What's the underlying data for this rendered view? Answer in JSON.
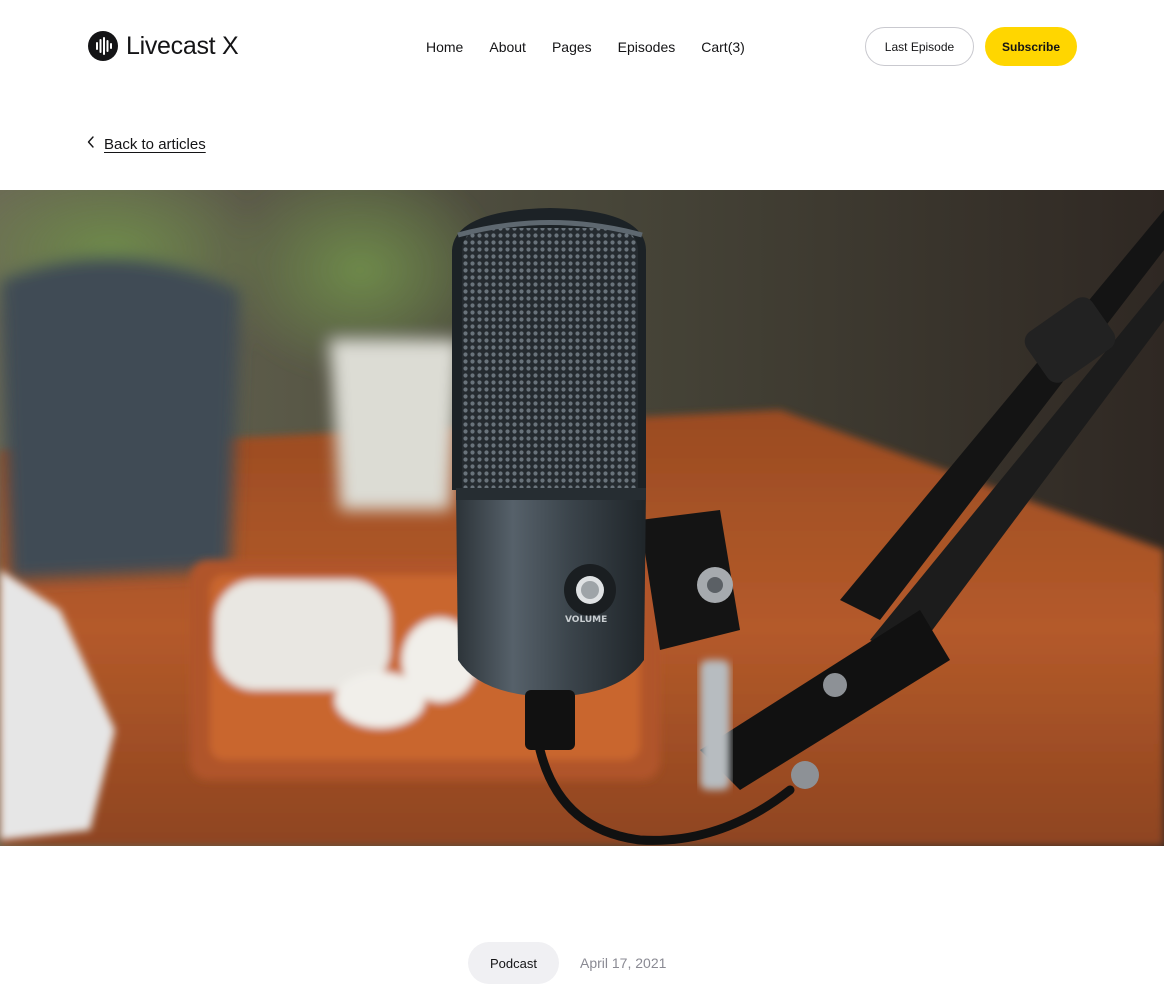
{
  "brand": {
    "name": "Livecast X",
    "logo_icon": "sound-wave-icon"
  },
  "nav": {
    "items": [
      "Home",
      "About",
      "Pages",
      "Episodes",
      "Cart(3)"
    ]
  },
  "header_buttons": {
    "last_episode": "Last Episode",
    "subscribe": "Subscribe"
  },
  "back": {
    "label": "Back to articles",
    "icon": "chevron-left-icon"
  },
  "hero": {
    "subject": "microphone-photo"
  },
  "meta": {
    "category": "Podcast",
    "date": "April 17, 2021"
  },
  "colors": {
    "accent": "#ffd600",
    "text": "#141416",
    "muted": "#8a8a93",
    "tag_bg": "#f0f0f3"
  }
}
